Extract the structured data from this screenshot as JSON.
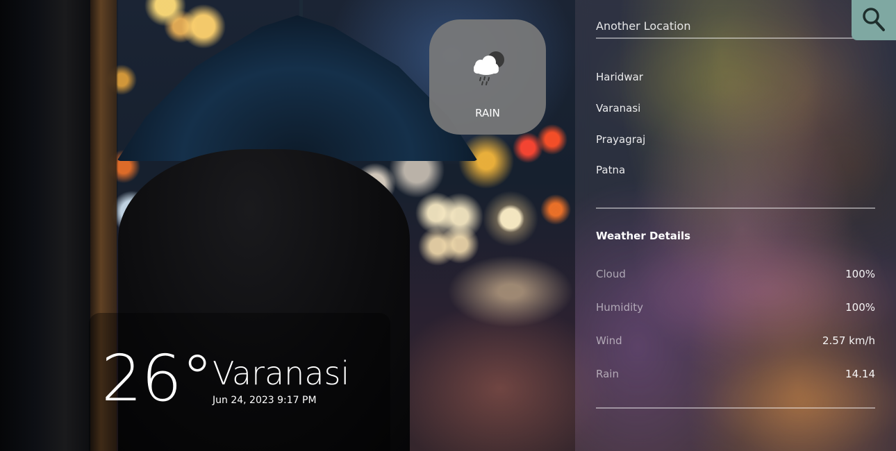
{
  "current": {
    "temperature": "26°",
    "city": "Varanasi",
    "date_time": "Jun 24, 2023 9:17 PM"
  },
  "condition": {
    "label": "RAIN",
    "icon": "cloud-rain-moon-icon"
  },
  "search": {
    "placeholder": "Another Location",
    "button_icon": "search-icon"
  },
  "cities": [
    "Haridwar",
    "Varanasi",
    "Prayagraj",
    "Patna"
  ],
  "details": {
    "title": "Weather Details",
    "rows": [
      {
        "label": "Cloud",
        "value": "100%"
      },
      {
        "label": "Humidity",
        "value": "100%"
      },
      {
        "label": "Wind",
        "value": "2.57 km/h"
      },
      {
        "label": "Rain",
        "value": "14.14"
      }
    ]
  },
  "colors": {
    "search_button": "#7fa8a2",
    "condition_card": "#7a7a7a",
    "text": "#ffffff"
  }
}
